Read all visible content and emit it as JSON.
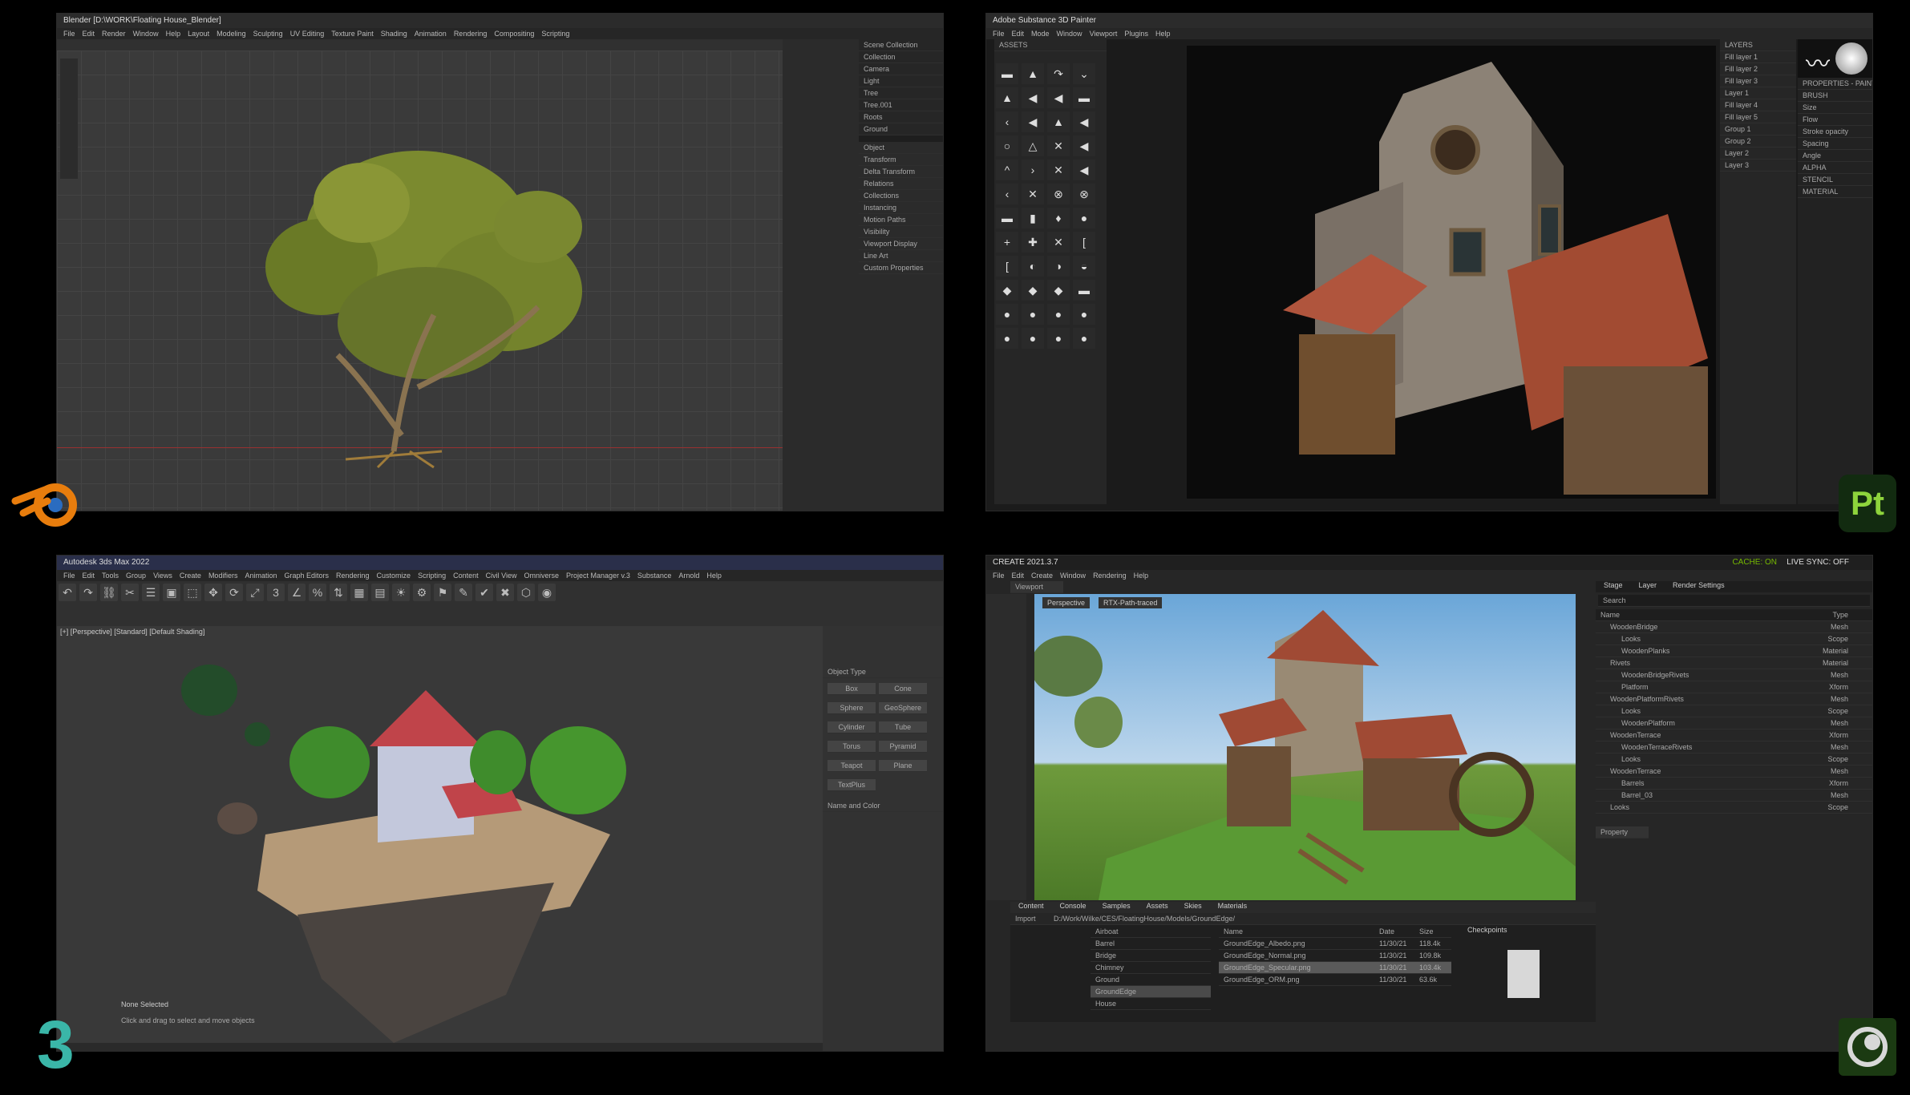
{
  "blender": {
    "title": "Blender [D:\\WORK\\Floating House_Blender]",
    "menu": [
      "File",
      "Edit",
      "Render",
      "Window",
      "Help",
      "Layout",
      "Modeling",
      "Sculpting",
      "UV Editing",
      "Texture Paint",
      "Shading",
      "Animation",
      "Rendering",
      "Compositing",
      "Scripting"
    ],
    "outliner_rows": [
      "Scene Collection",
      "Collection",
      "Camera",
      "Light",
      "Tree",
      "Tree.001",
      "Roots",
      "Ground"
    ],
    "props_rows": [
      "Object",
      "Transform",
      "Delta Transform",
      "Relations",
      "Collections",
      "Instancing",
      "Motion Paths",
      "Visibility",
      "Viewport Display",
      "Line Art",
      "Custom Properties"
    ]
  },
  "painter": {
    "title": "Adobe Substance 3D Painter",
    "menu": [
      "File",
      "Edit",
      "Mode",
      "Window",
      "Viewport",
      "Plugins",
      "Help"
    ],
    "shelf_title": "ASSETS",
    "layers_title": "LAYERS",
    "layer_rows": [
      "Fill layer 1",
      "Fill layer 2",
      "Fill layer 3",
      "Layer 1",
      "Fill layer 4",
      "Fill layer 5",
      "Group 1",
      "Group 2",
      "Layer 2",
      "Layer 3"
    ],
    "props_title": "PROPERTIES - PAINT",
    "props_rows": [
      "BRUSH",
      "Size",
      "Flow",
      "Stroke opacity",
      "Spacing",
      "Angle",
      "ALPHA",
      "STENCIL",
      "MATERIAL"
    ],
    "logo": "Pt",
    "brush_icons": [
      "▬",
      "▲",
      "↷",
      "⌄",
      "▲",
      "◀",
      "◀",
      "▬",
      "‹",
      "◀",
      "▲",
      "◀",
      "○",
      "△",
      "✕",
      "◀",
      "^",
      "›",
      "✕",
      "◀",
      "‹",
      "✕",
      "⊗",
      "⊗",
      "▬",
      "▮",
      "♦",
      "●",
      "+",
      "✚",
      "✕",
      "[",
      "[",
      "◐",
      "◑",
      "◒",
      "◆",
      "◆",
      "◆",
      "▬",
      "●",
      "●",
      "●",
      "●",
      "●",
      "●",
      "●",
      "●"
    ]
  },
  "max": {
    "title": "Autodesk 3ds Max 2022",
    "menu": [
      "File",
      "Edit",
      "Tools",
      "Group",
      "Views",
      "Create",
      "Modifiers",
      "Animation",
      "Graph Editors",
      "Rendering",
      "Customize",
      "Scripting",
      "Content",
      "Civil View",
      "Omniverse",
      "Project Manager v.3",
      "Substance",
      "Arnold",
      "Help"
    ],
    "viewport_label": "[+] [Perspective] [Standard] [Default Shading]",
    "panel_section": "Object Type",
    "panel_buttons": [
      "Box",
      "Cone",
      "Sphere",
      "GeoSphere",
      "Cylinder",
      "Tube",
      "Torus",
      "Pyramid",
      "Teapot",
      "Plane",
      "TextPlus"
    ],
    "name_color": "Name and Color",
    "status_selected": "None Selected",
    "status_hint": "Click and drag to select and move objects",
    "logo": "3"
  },
  "omni": {
    "title": "CREATE 2021.3.7",
    "menu": [
      "File",
      "Edit",
      "Create",
      "Window",
      "Rendering",
      "Help"
    ],
    "cache": "CACHE: ON",
    "live_sync": "LIVE SYNC: OFF",
    "viewport_tab": "Viewport",
    "perspective": "Perspective",
    "rtx": "RTX-Path-traced",
    "stage_tabs": [
      "Stage",
      "Layer",
      "Render Settings"
    ],
    "stage_search": "Search",
    "stage_header": [
      "Name",
      "Type"
    ],
    "stage_rows": [
      [
        "WoodenBridge",
        "Mesh"
      ],
      [
        "Looks",
        "Scope"
      ],
      [
        "WoodenPlanks",
        "Material"
      ],
      [
        "Rivets",
        "Material"
      ],
      [
        "WoodenBridgeRivets",
        "Mesh"
      ],
      [
        "Platform",
        "Xform"
      ],
      [
        "WoodenPlatformRivets",
        "Mesh"
      ],
      [
        "Looks",
        "Scope"
      ],
      [
        "WoodenPlatform",
        "Mesh"
      ],
      [
        "WoodenTerrace",
        "Xform"
      ],
      [
        "WoodenTerraceRivets",
        "Mesh"
      ],
      [
        "Looks",
        "Scope"
      ],
      [
        "WoodenTerrace",
        "Mesh"
      ],
      [
        "Barrels",
        "Xform"
      ],
      [
        "Barrel_03",
        "Mesh"
      ],
      [
        "Looks",
        "Scope"
      ]
    ],
    "property_tab": "Property",
    "content_tabs": [
      "Content",
      "Console",
      "Samples",
      "Assets",
      "Skies",
      "Materials"
    ],
    "content_path": "D:/Work/Wilke/CES/FloatingHouse/Models/GroundEdge/",
    "import": "Import",
    "folders": [
      "Airboat",
      "Barrel",
      "Bridge",
      "Chimney",
      "Ground",
      "GroundEdge",
      "House"
    ],
    "files": [
      [
        "GroundEdge_Albedo.png",
        "11/30/21",
        "118.4k"
      ],
      [
        "GroundEdge_Normal.png",
        "11/30/21",
        "109.8k"
      ],
      [
        "GroundEdge_Specular.png",
        "11/30/21",
        "103.4k"
      ],
      [
        "GroundEdge_ORM.png",
        "11/30/21",
        "63.6k"
      ]
    ],
    "file_header": [
      "Name",
      "Date",
      "Size"
    ],
    "checkpoints": "Checkpoints"
  },
  "colors": {
    "blender_orange": "#e87d0d",
    "painter_green": "#7cb82f",
    "max_teal": "#3ab6a8",
    "omni_green": "#76b900"
  }
}
